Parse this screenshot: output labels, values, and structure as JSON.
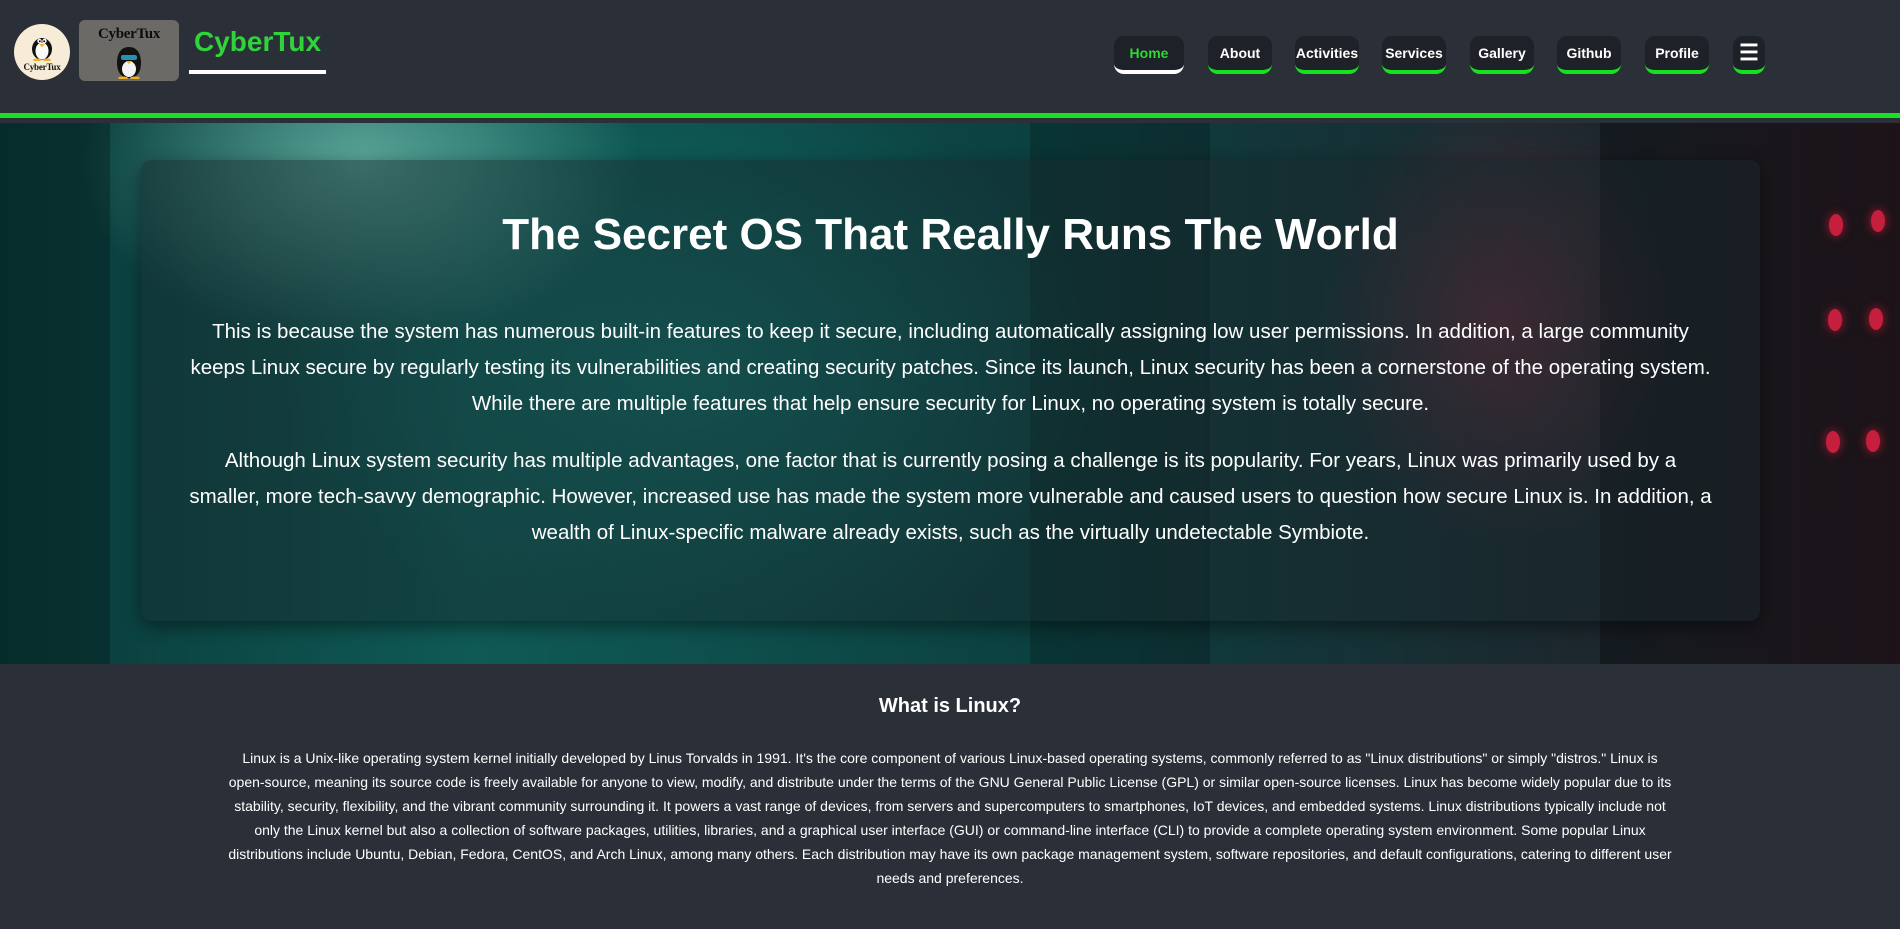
{
  "header": {
    "logo_circle_text": "CyberTux",
    "logo_card_text": "CyberTux",
    "brand": "CyberTux"
  },
  "nav": {
    "items": [
      {
        "label": "Home",
        "active": true
      },
      {
        "label": "About"
      },
      {
        "label": "Activities"
      },
      {
        "label": "Services"
      },
      {
        "label": "Gallery"
      },
      {
        "label": "Github"
      },
      {
        "label": "Profile"
      }
    ],
    "menu_icon": "☰"
  },
  "hero": {
    "title": "The Secret OS That Really Runs The World",
    "paragraph1": "This is because the system has numerous built-in features to keep it secure, including automatically assigning low user permissions. In addition, a large community keeps Linux secure by regularly testing its vulnerabilities and creating security patches. Since its launch, Linux security has been a cornerstone of the operating system. While there are multiple features that help ensure security for Linux, no operating system is totally secure.",
    "paragraph2": "Although Linux system security has multiple advantages, one factor that is currently posing a challenge is its popularity. For years, Linux was primarily used by a smaller, more tech-savvy demographic. However, increased use has made the system more vulnerable and caused users to question how secure Linux is. In addition, a wealth of Linux-specific malware already exists, such as the virtually undetectable Symbiote."
  },
  "about": {
    "title": "What is Linux?",
    "text": "Linux is a Unix-like operating system kernel initially developed by Linus Torvalds in 1991. It's the core component of various Linux-based operating systems, commonly referred to as \"Linux distributions\" or simply \"distros.\" Linux is open-source, meaning its source code is freely available for anyone to view, modify, and distribute under the terms of the GNU General Public License (GPL) or similar open-source licenses. Linux has become widely popular due to its stability, security, flexibility, and the vibrant community surrounding it. It powers a vast range of devices, from servers and supercomputers to smartphones, IoT devices, and embedded systems. Linux distributions typically include not only the Linux kernel but also a collection of software packages, utilities, libraries, and a graphical user interface (GUI) or command-line interface (CLI) to provide a complete operating system environment. Some popular Linux distributions include Ubuntu, Debian, Fedora, CentOS, and Arch Linux, among many others. Each distribution may have its own package management system, software repositories, and default configurations, catering to different user needs and preferences."
  },
  "colors": {
    "accent_green": "#18e21f",
    "brand_green": "#2fd33a",
    "background": "#2b2f38",
    "nav_button": "#1e2127"
  }
}
